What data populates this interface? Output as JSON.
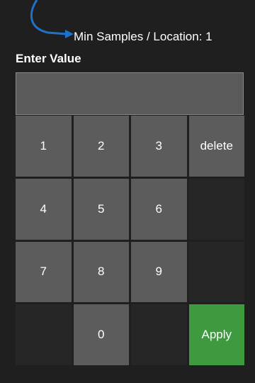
{
  "callout": {
    "label": "Min Samples / Location: 1",
    "arrow_color": "#1e73c8"
  },
  "keypad": {
    "title": "Enter Value",
    "display_value": "",
    "keys": {
      "k1": "1",
      "k2": "2",
      "k3": "3",
      "delete": "delete",
      "k4": "4",
      "k5": "5",
      "k6": "6",
      "k7": "7",
      "k8": "8",
      "k9": "9",
      "k0": "0",
      "apply": "Apply"
    },
    "apply_color": "#3e9a3e"
  }
}
